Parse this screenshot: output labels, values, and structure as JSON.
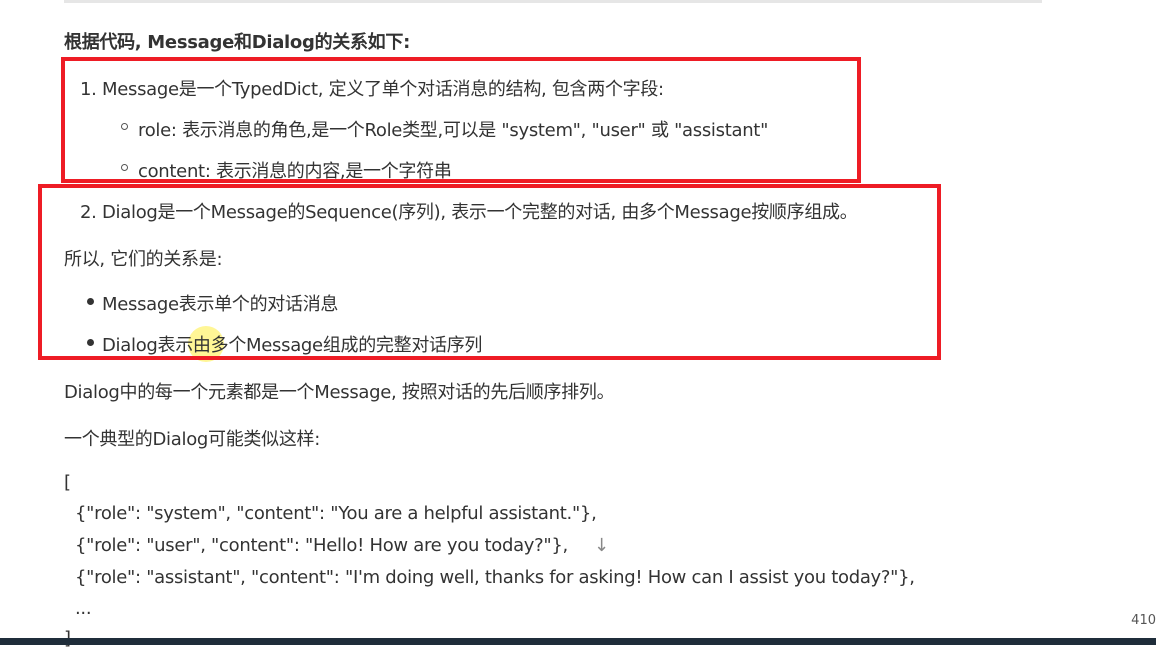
{
  "heading": "根据代码, Message和Dialog的关系如下:",
  "item1": "1. Message是一个TypedDict, 定义了单个对话消息的结构, 包含两个字段:",
  "sub1": "role: 表示消息的角色,是一个Role类型,可以是 \"system\", \"user\" 或 \"assistant\"",
  "sub2": "content: 表示消息的内容,是一个字符串",
  "item2": "2. Dialog是一个Message的Sequence(序列), 表示一个完整的对话, 由多个Message按顺序组成。",
  "so": "所以, 它们的关系是:",
  "b1": "Message表示单个的对话消息",
  "b2": "Dialog表示由多个Message组成的完整对话序列",
  "p1": "Dialog中的每一个元素都是一个Message, 按照对话的先后顺序排列。",
  "p2": "一个典型的Dialog可能类似这样:",
  "code": [
    "[",
    "{\"role\": \"system\", \"content\": \"You are a helpful assistant.\"},",
    "{\"role\": \"user\", \"content\": \"Hello! How are you today?\"},",
    "{\"role\": \"assistant\", \"content\": \"I'm doing well, thanks for asking! How can I assist you today?\"},",
    "...",
    "]"
  ],
  "arrow": "↓",
  "page_number": "410"
}
